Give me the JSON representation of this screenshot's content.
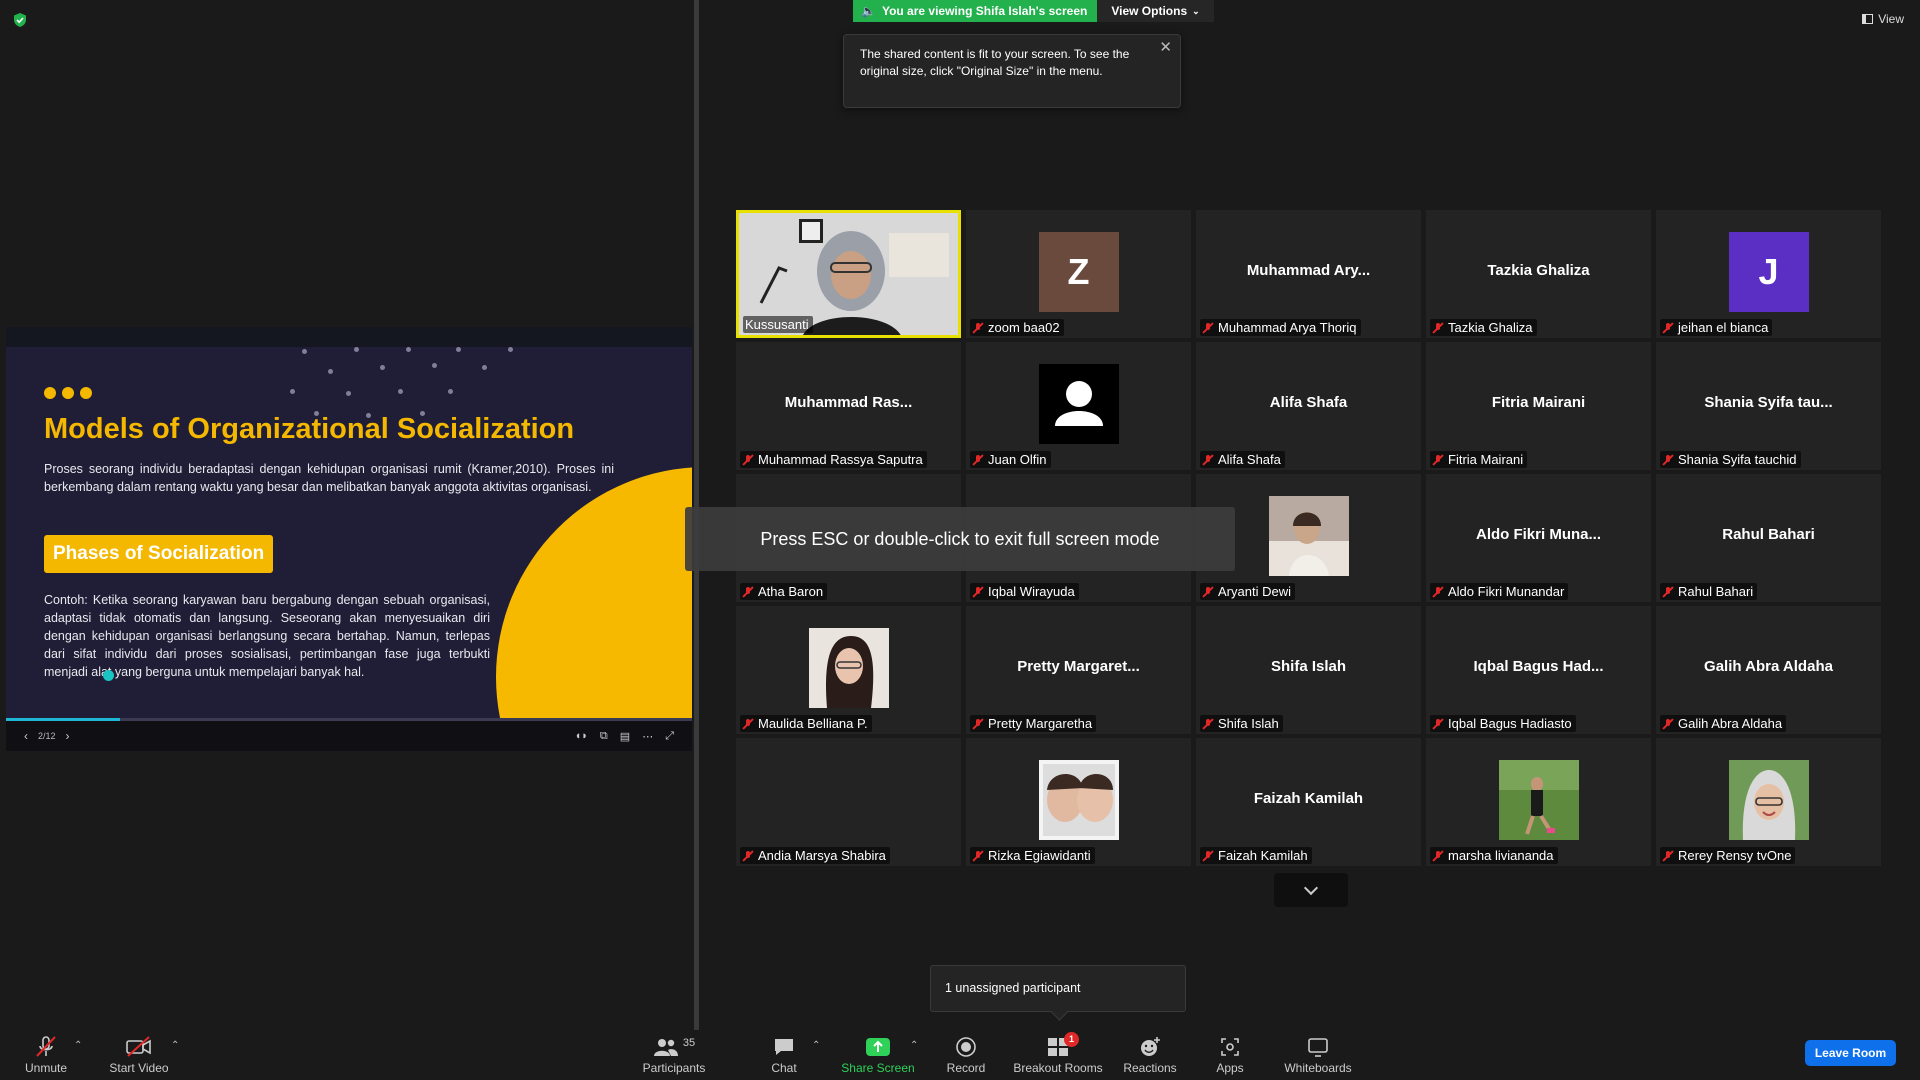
{
  "slide": {
    "title": "Models of Organizational Socialization",
    "intro": "Proses seorang individu beradaptasi dengan kehidupan organisasi rumit (Kramer,2010). Proses ini berkembang dalam rentang waktu yang besar dan melibatkan banyak anggota aktivitas organisasi.",
    "section_heading": "Phases of Socialization",
    "body": "Contoh: Ketika seorang karyawan baru bergabung dengan sebuah organisasi, adaptasi tidak otomatis dan langsung. Seseorang akan menyesuaikan diri dengan kehidupan organisasi berlangsung secara bertahap. Namun, terlepas dari sifat individu dari proses sosialisasi, pertimbangan fase juga terbukti menjadi alat yang berguna untuk mempelajari banyak hal.",
    "page_indicator": "2/12",
    "progress": 0.166
  },
  "share_banner": {
    "viewing_text": "You are viewing Shifa Islah's screen",
    "view_options": "View Options"
  },
  "fit_tooltip": "The shared content is fit to your screen. To see the original size, click \"Original Size\" in the menu.",
  "view_label": "View",
  "esc_message": "Press ESC or double-click to exit full screen mode",
  "unassigned_text": "1 unassigned participant",
  "participants": [
    {
      "big": "",
      "name": "Kussusanti",
      "type": "video",
      "muted": false,
      "active": true
    },
    {
      "big": "Z",
      "name": "zoom baa02",
      "type": "letter",
      "color": "#6b4a3e",
      "muted": true
    },
    {
      "big": "Muhammad  Ary...",
      "name": "Muhammad Arya Thoriq",
      "type": "text",
      "muted": true
    },
    {
      "big": "Tazkia Ghaliza",
      "name": "Tazkia Ghaliza",
      "type": "text",
      "muted": true
    },
    {
      "big": "J",
      "name": "jeihan el bianca",
      "type": "letter",
      "color": "#5b2fc4",
      "muted": true
    },
    {
      "big": "Muhammad  Ras...",
      "name": "Muhammad Rassya Saputra",
      "type": "text",
      "muted": true
    },
    {
      "big": "",
      "name": "Juan Olfin",
      "type": "generic",
      "muted": true
    },
    {
      "big": "Alifa Shafa",
      "name": "Alifa Shafa",
      "type": "text",
      "muted": true
    },
    {
      "big": "Fitria Mairani",
      "name": "Fitria Mairani",
      "type": "text",
      "muted": true
    },
    {
      "big": "Shania  Syifa  tau...",
      "name": "Shania Syifa tauchid",
      "type": "text",
      "muted": true
    },
    {
      "big": "",
      "name": "Atha Baron",
      "type": "text",
      "muted": true
    },
    {
      "big": "",
      "name": "Iqbal Wirayuda",
      "type": "text",
      "muted": true
    },
    {
      "big": "",
      "name": "Aryanti Dewi",
      "type": "photo",
      "photo": "p1",
      "muted": true
    },
    {
      "big": "Aldo  Fikri  Muna...",
      "name": "Aldo Fikri Munandar",
      "type": "text",
      "muted": true
    },
    {
      "big": "Rahul Bahari",
      "name": "Rahul Bahari",
      "type": "text",
      "muted": true
    },
    {
      "big": "",
      "name": "Maulida Belliana P.",
      "type": "photo",
      "photo": "p2",
      "muted": true
    },
    {
      "big": "Pretty  Margaret...",
      "name": "Pretty Margaretha",
      "type": "text",
      "muted": true
    },
    {
      "big": "Shifa Islah",
      "name": "Shifa Islah",
      "type": "text",
      "muted": true
    },
    {
      "big": "Iqbal  Bagus  Had...",
      "name": "Iqbal Bagus Hadiasto",
      "type": "text",
      "muted": true
    },
    {
      "big": "Galih Abra Aldaha",
      "name": "Galih Abra Aldaha",
      "type": "text",
      "muted": true
    },
    {
      "big": "",
      "name": "Andia Marsya Shabira",
      "type": "text",
      "muted": true
    },
    {
      "big": "",
      "name": "Rizka Egiawidanti",
      "type": "photo",
      "photo": "p3",
      "muted": true
    },
    {
      "big": "Faizah Kamilah",
      "name": "Faizah Kamilah",
      "type": "text",
      "muted": true
    },
    {
      "big": "",
      "name": "marsha liviananda",
      "type": "photo",
      "photo": "p4",
      "muted": true
    },
    {
      "big": "",
      "name": "Rerey Rensy tvOne",
      "type": "photo",
      "photo": "p5",
      "muted": true
    }
  ],
  "toolbar": {
    "unmute": "Unmute",
    "start_video": "Start Video",
    "participants": "Participants",
    "participants_count": "35",
    "chat": "Chat",
    "share_screen": "Share Screen",
    "record": "Record",
    "breakout_rooms": "Breakout Rooms",
    "breakout_badge": "1",
    "reactions": "Reactions",
    "apps": "Apps",
    "whiteboards": "Whiteboards",
    "leave": "Leave Room"
  },
  "colors": {
    "accent_yellow": "#f5b800",
    "share_green": "#22b14c",
    "leave_blue": "#0e71eb",
    "muted_red": "#e02828",
    "active_border": "#e8e000"
  }
}
